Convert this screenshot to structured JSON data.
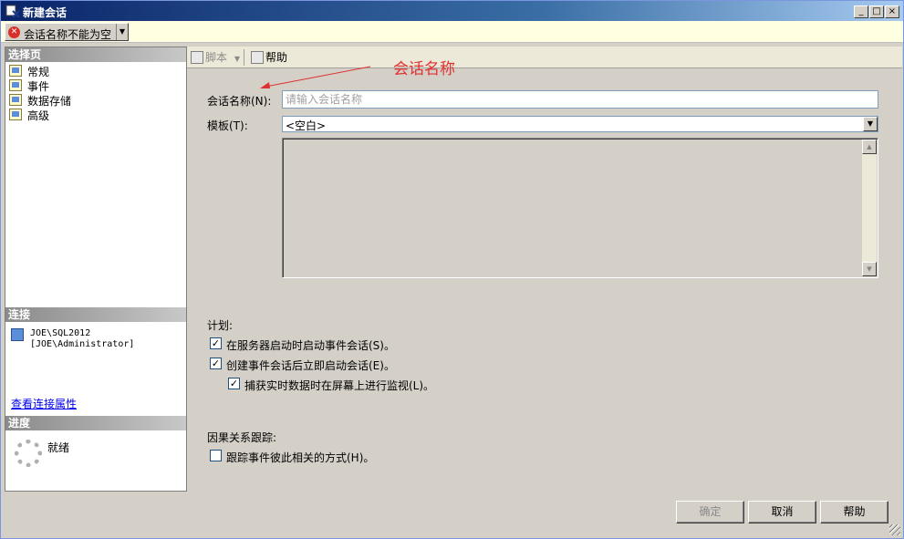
{
  "window": {
    "title": "新建会话",
    "minimize_glyph": "_",
    "maximize_glyph": "□",
    "close_glyph": "×"
  },
  "error_bar": {
    "message": "会话名称不能为空"
  },
  "left_pane": {
    "select_page_header": "选择页",
    "pages": [
      {
        "label": "常规"
      },
      {
        "label": "事件"
      },
      {
        "label": "数据存储"
      },
      {
        "label": "高级"
      }
    ],
    "connection_header": "连接",
    "connection_server": "JOE\\SQL2012",
    "connection_user": "[JOE\\Administrator]",
    "connection_properties_link": "查看连接属性",
    "progress_header": "进度",
    "progress_status": "就绪"
  },
  "toolbar": {
    "script_label": "脚本",
    "help_label": "帮助"
  },
  "annotation": {
    "text": "会话名称",
    "color": "#e03030"
  },
  "form": {
    "session_name_label": "会话名称(N):",
    "session_name_placeholder": "请输入会话名称",
    "session_name_value": "",
    "template_label": "模板(T):",
    "template_value": "<空白>",
    "schedule_header": "计划:",
    "start_on_server_start_label": "在服务器启动时启动事件会话(S)。",
    "start_on_server_start_checked": true,
    "start_immediately_label": "创建事件会话后立即启动会话(E)。",
    "start_immediately_checked": true,
    "watch_live_data_label": "捕获实时数据时在屏幕上进行监视(L)。",
    "watch_live_data_checked": true,
    "causality_header": "因果关系跟踪:",
    "track_causality_label": "跟踪事件彼此相关的方式(H)。",
    "track_causality_checked": false
  },
  "buttons": {
    "ok": "确定",
    "cancel": "取消",
    "help": "帮助"
  }
}
